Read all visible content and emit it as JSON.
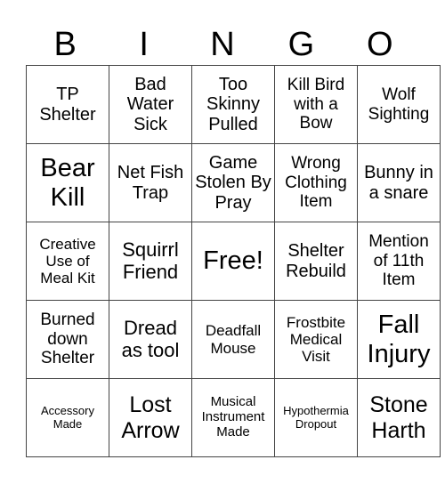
{
  "header": {
    "letters": [
      "B",
      "I",
      "N",
      "G",
      "O"
    ]
  },
  "grid": {
    "rows": [
      [
        "TP Shelter",
        "Bad Water Sick",
        "Too Skinny Pulled",
        "Kill Bird with a Bow",
        "Wolf Sighting"
      ],
      [
        "Bear Kill",
        "Net Fish Trap",
        "Game Stolen By Pray",
        "Wrong Clothing Item",
        "Bunny in a snare"
      ],
      [
        "Creative Use of Meal Kit",
        "Squirrl Friend",
        "Free!",
        "Shelter Rebuild",
        "Mention of 11th Item"
      ],
      [
        "Burned down Shelter",
        "Dread as tool",
        "Deadfall Mouse",
        "Frostbite Medical Visit",
        "Fall Injury"
      ],
      [
        "Accessory Made",
        "Lost Arrow",
        "Musical Instrument Made",
        "Hypothermia Dropout",
        "Stone Harth"
      ]
    ]
  }
}
